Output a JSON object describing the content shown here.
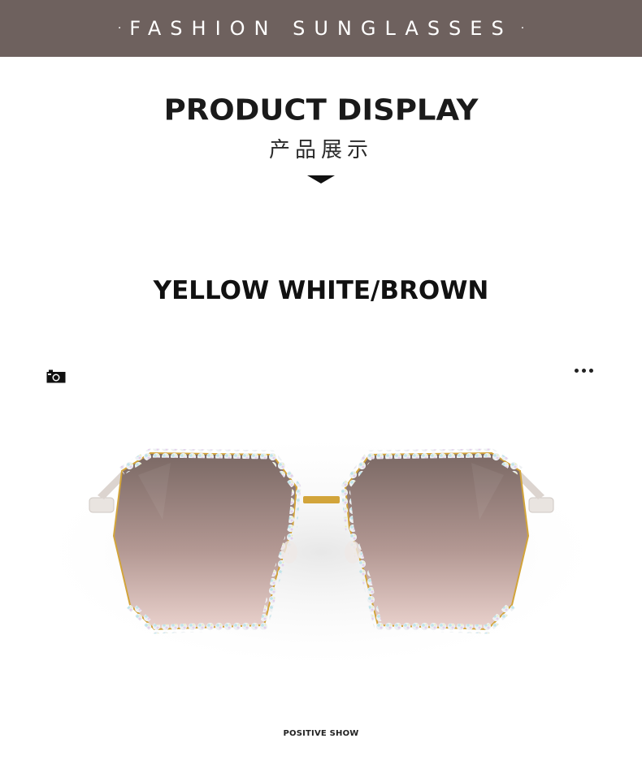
{
  "banner": {
    "title": "FASHION SUNGLASSES",
    "dot": "·"
  },
  "heading": {
    "title": "PRODUCT DISPLAY",
    "subtitle": "产品展示"
  },
  "product": {
    "color_name": "YELLOW WHITE/BROWN",
    "caption": "POSITIVE SHOW"
  },
  "colors": {
    "banner_bg": "#6e615e",
    "lens_top": "#7d6a67",
    "lens_bottom": "#e3c8c3",
    "frame_gold": "#d2a43a"
  },
  "icons": {
    "camera": "camera-icon",
    "more": "more-dots-icon"
  }
}
